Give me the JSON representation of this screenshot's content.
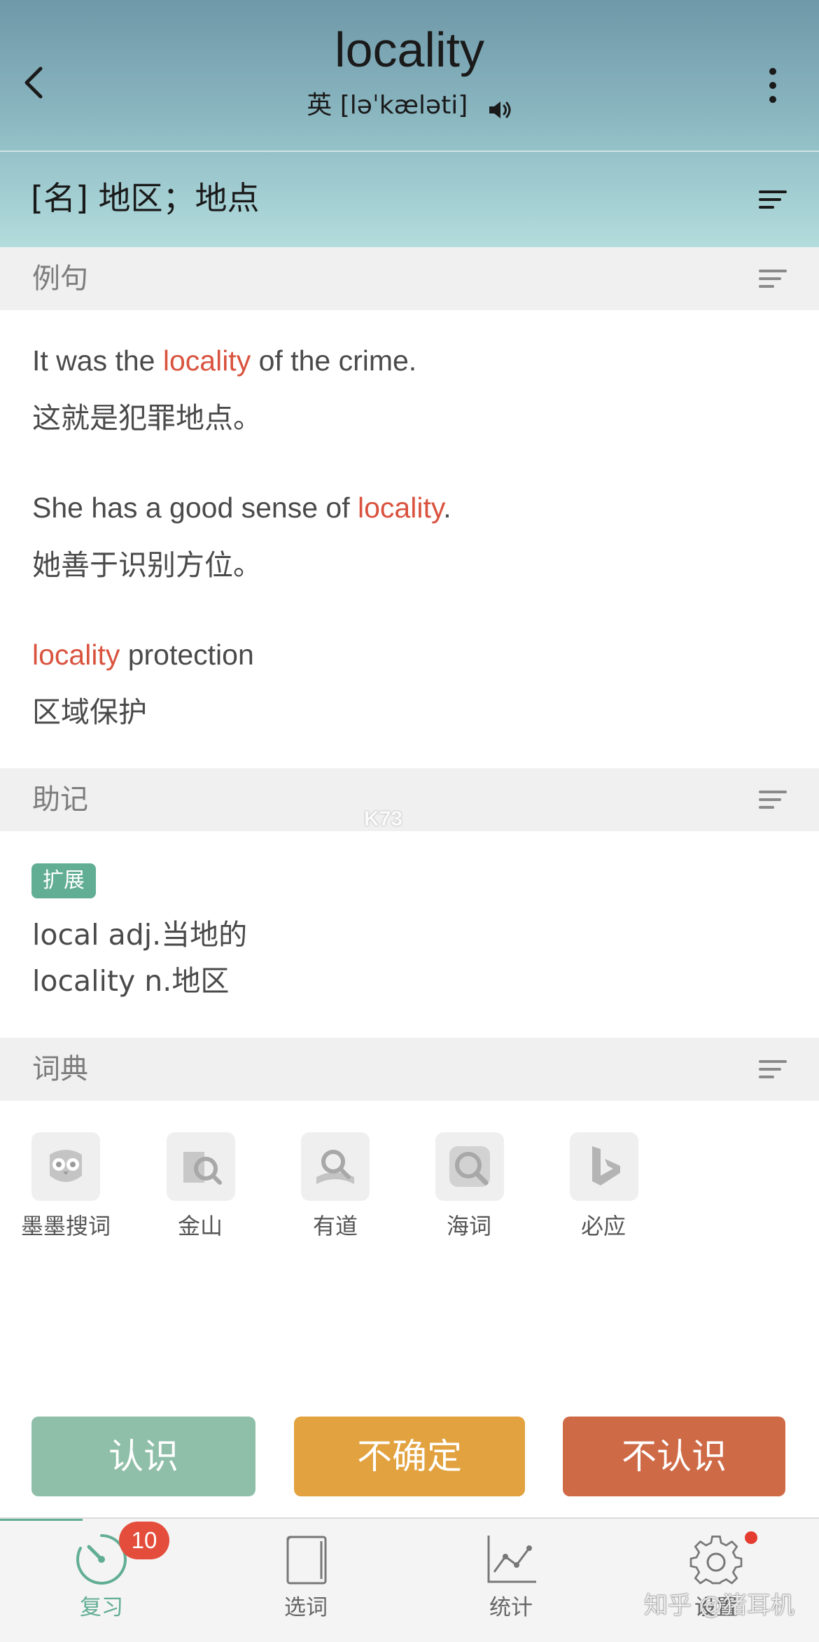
{
  "header": {
    "word": "locality",
    "phonetic_prefix": "英",
    "phonetic": "[ləˈkæləti]",
    "definition": "[名] 地区；地点"
  },
  "sections": {
    "examples_title": "例句",
    "mnemonic_title": "助记",
    "dictionary_title": "词典"
  },
  "examples": [
    {
      "before": "It was the ",
      "highlight": "locality",
      "after": " of the crime.",
      "zh": "这就是犯罪地点。"
    },
    {
      "before": "She has a good sense of ",
      "highlight": "locality",
      "after": ".",
      "zh": "她善于识别方位。"
    },
    {
      "before": "",
      "highlight": "locality",
      "after": " protection",
      "zh": "区域保护"
    }
  ],
  "mnemonic": {
    "tag": "扩展",
    "lines": [
      "local adj.当地的",
      "locality n.地区"
    ]
  },
  "dictionaries": [
    {
      "label": "墨墨搜词",
      "icon": "owl-icon"
    },
    {
      "label": "金山",
      "icon": "kingsoft-search-icon"
    },
    {
      "label": "有道",
      "icon": "youdao-search-icon"
    },
    {
      "label": "海词",
      "icon": "dict-cn-search-icon"
    },
    {
      "label": "必应",
      "icon": "bing-icon"
    }
  ],
  "actions": {
    "know": "认识",
    "unsure": "不确定",
    "unknown": "不认识"
  },
  "tabs": [
    {
      "label": "复习",
      "icon": "review-timer-icon",
      "active": true
    },
    {
      "label": "选词",
      "icon": "book-icon",
      "active": false
    },
    {
      "label": "统计",
      "icon": "chart-icon",
      "active": false
    },
    {
      "label": "设置",
      "icon": "gear-icon",
      "active": false
    }
  ],
  "badge": {
    "count": "10"
  },
  "watermarks": {
    "site": "K73",
    "zhihu": "知乎 @猪耳机"
  },
  "colors": {
    "accent": "#62ae95",
    "highlight": "#d9533f",
    "know": "#8fbfa8",
    "unsure": "#e2a23f",
    "unknown": "#cf6a47",
    "badge": "#e44d3c"
  }
}
